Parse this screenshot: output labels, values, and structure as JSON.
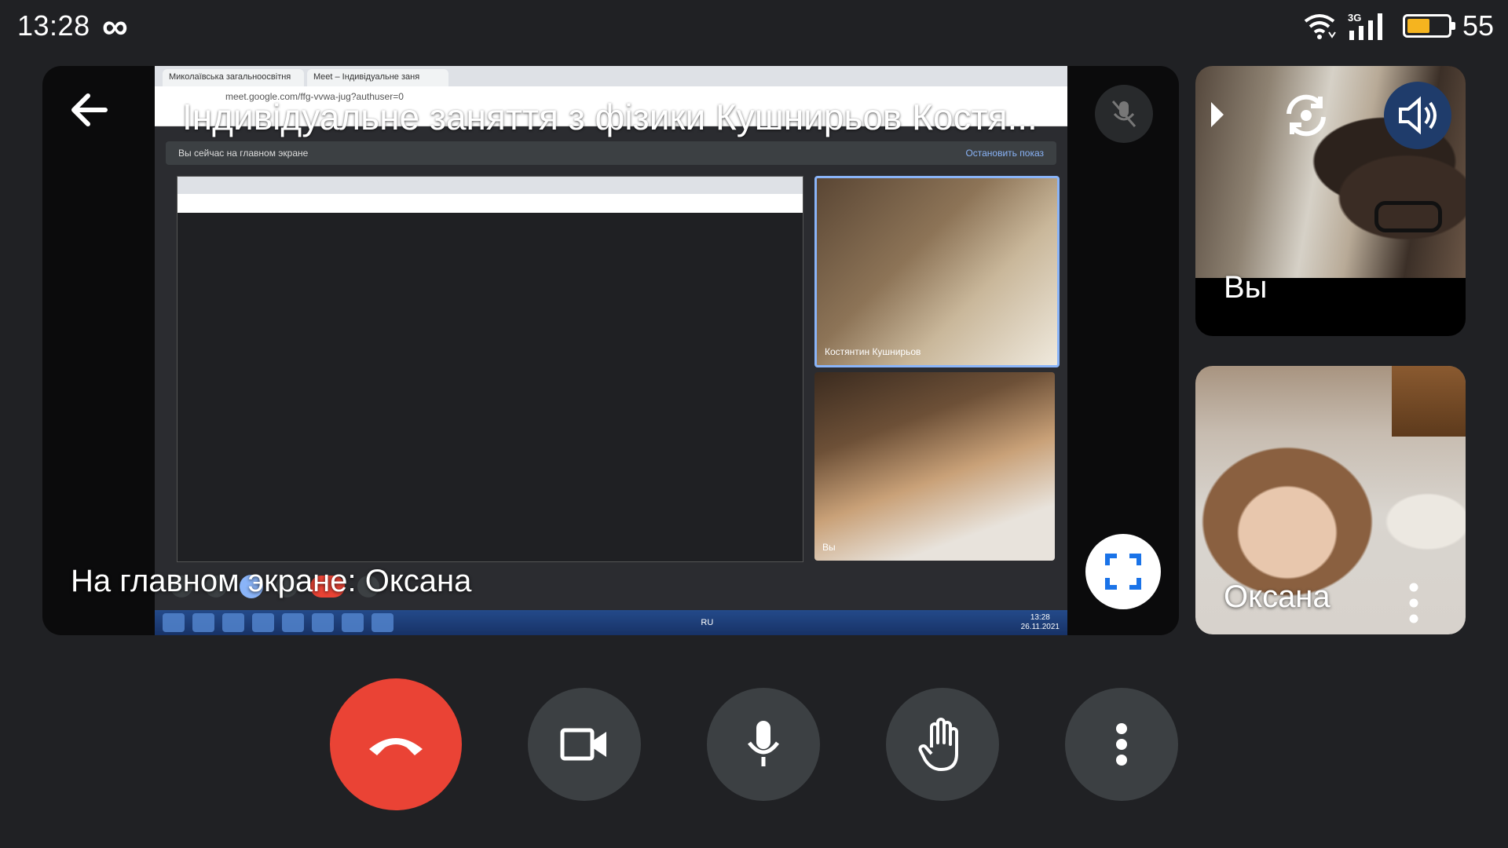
{
  "status_bar": {
    "time": "13:28",
    "network": "3G",
    "battery_level": "55",
    "battery_fraction": 0.55,
    "battery_color": "#f5b41f"
  },
  "meeting": {
    "title": "Індивідуальне заняття з фізики Кушнирьов Костя...",
    "presentation_caption": "На главном экране: Оксана"
  },
  "participants": {
    "self": {
      "name": "Вы"
    },
    "other": {
      "name": "Оксана"
    }
  },
  "shared_screen": {
    "tabs": [
      "Миколаївська загальноосвітня",
      "Meet – Індивідуальне заня"
    ],
    "url": "meet.google.com/ffg-vvwa-jug?authuser=0",
    "banner_text": "Вы сейчас на главном экране",
    "banner_stop": "Остановить показ",
    "tile_boy_name": "Костянтин Кушнирьов",
    "tile_woman_name": "Вы",
    "clock_time": "13:28",
    "clock_date": "26.11.2021",
    "lang": "RU"
  },
  "colors": {
    "end_call": "#ea4335",
    "control_bg": "#3c4043",
    "background": "#202124",
    "accent_blue": "#1a73e8"
  },
  "icons": {
    "back": "arrow-left-icon",
    "switch_camera": "switch-camera-icon",
    "speaker": "speaker-icon",
    "fullscreen": "fullscreen-icon",
    "end_call": "phone-hangup-icon",
    "camera": "videocam-icon",
    "mic": "mic-icon",
    "hand": "raise-hand-icon",
    "more": "more-vert-icon"
  }
}
